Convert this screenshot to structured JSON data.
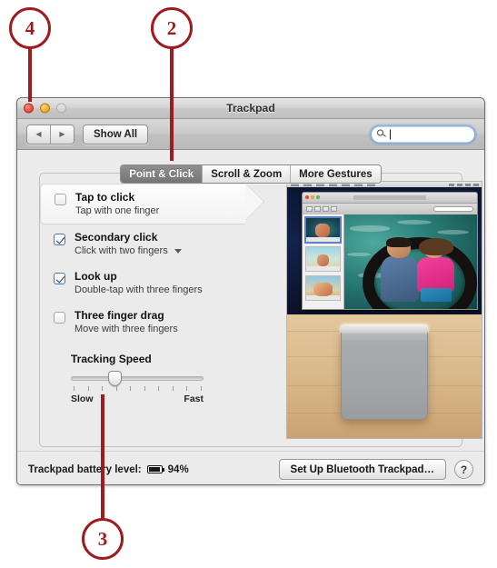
{
  "callouts": [
    {
      "number": "4"
    },
    {
      "number": "2"
    },
    {
      "number": "3"
    }
  ],
  "window": {
    "title": "Trackpad",
    "traffic_lights": [
      "close-button",
      "minimize-button",
      "zoom-button"
    ],
    "toolbar": {
      "back_label": "◀",
      "forward_label": "▶",
      "show_all_label": "Show All",
      "search": {
        "value": "",
        "placeholder": "",
        "icon": "search-icon"
      }
    },
    "tabs": [
      {
        "label": "Point & Click",
        "active": true
      },
      {
        "label": "Scroll & Zoom",
        "active": false
      },
      {
        "label": "More Gestures",
        "active": false
      }
    ],
    "options": [
      {
        "title": "Tap to click",
        "subtitle": "Tap with one finger",
        "checked": false,
        "highlighted": true,
        "has_dropdown": false
      },
      {
        "title": "Secondary click",
        "subtitle": "Click with two fingers",
        "checked": true,
        "highlighted": false,
        "has_dropdown": true
      },
      {
        "title": "Look up",
        "subtitle": "Double-tap with three fingers",
        "checked": true,
        "highlighted": false,
        "has_dropdown": false
      },
      {
        "title": "Three finger drag",
        "subtitle": "Move with three fingers",
        "checked": false,
        "highlighted": false,
        "has_dropdown": false
      }
    ],
    "slider": {
      "label": "Tracking Speed",
      "min_label": "Slow",
      "max_label": "Fast",
      "ticks": 10,
      "value_index": 3
    },
    "bottom": {
      "battery_label": "Trackpad battery level:",
      "battery_icon": "battery-icon",
      "battery_percent": "94%",
      "setup_button": "Set Up Bluetooth Trackpad…",
      "help_button": "?"
    }
  },
  "colors": {
    "callout": "#9e1b20",
    "window_bg": "#ebebeb",
    "tab_active_bg": "#7f7f7f",
    "checkbox_on_border": "#4f79ad"
  }
}
